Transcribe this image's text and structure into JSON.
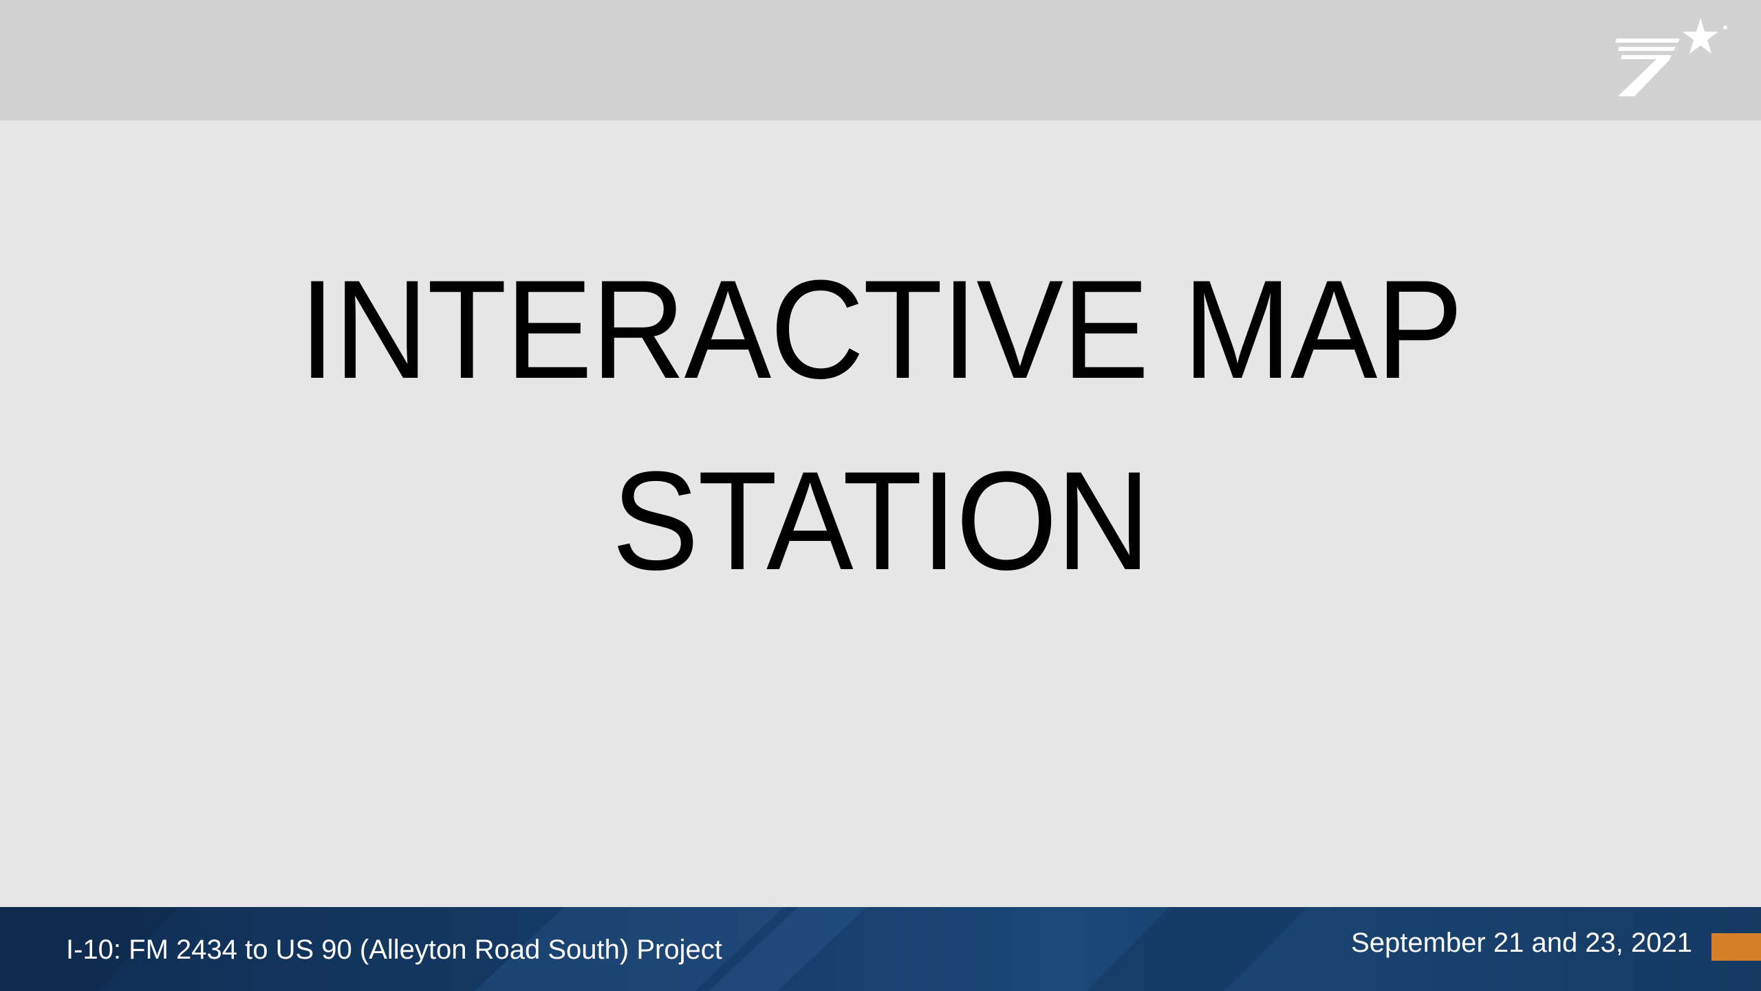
{
  "slide": {
    "title_lines": [
      "INTERACTIVE MAP",
      "STATION"
    ],
    "footer_left": "I-10: FM 2434 to US 90 (Alleyton Road South) Project",
    "footer_right": "September 21 and 23, 2021",
    "logo_icon": "txdot-flying-t-logo-icon"
  },
  "colors": {
    "background": "#e6e6e6",
    "top_band": "#d2d2d2",
    "footer": "#173f6d",
    "accent": "#d4802a",
    "title_text": "#000000",
    "footer_text": "#ffffff"
  }
}
